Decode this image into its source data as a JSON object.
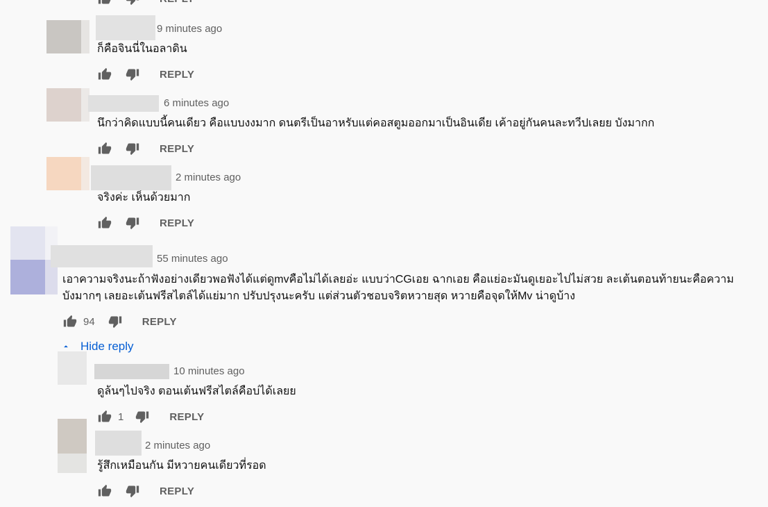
{
  "reply_label": "REPLY",
  "hide_reply_label": "Hide reply",
  "colors": {
    "link": "#065fd4",
    "meta": "#606060",
    "text": "#0f0f0f",
    "background": "#f9f9f9"
  },
  "comments": [
    {
      "time": "9 minutes ago",
      "text": "ก็คือจินนี่ในอลาดิน",
      "likes": ""
    },
    {
      "time": "6 minutes ago",
      "text": "นึกว่าคิดแบบนี้คนเดียว คือแบบงงมาก ดนตรีเป็นอาหรับแต่คอสตูมออกมาเป็นอินเดีย เค้าอยู่กันคนละทวีปเลยย บังมากก",
      "likes": ""
    },
    {
      "time": "2 minutes ago",
      "text": "จริงค่ะ เห็นด้วยมาก",
      "likes": ""
    },
    {
      "time": "55 minutes ago",
      "text_line1": "เอาความจริงนะถ้าฟังอย่างเดียวพอฟังได้แต่ดูmvคือไม่ได้เลยอ่ะ แบบว่าCGเอย ฉากเอย คือแย่อะมันดูเยอะไปไม่สวย ละเต้นตอนท้ายนะคือความ",
      "text_line2": "บังมากๆ เลยอะเต้นฟรีสไตล์ได้แย่มาก ปรับปรุงนะครับ แต่ส่วนตัวชอบจริตหวายสุด หวายคือจุดให้Mv น่าดูบ้าง",
      "likes": "94"
    },
    {
      "time": "10 minutes ago",
      "text": "ดูล้นๆไปจริง ตอนเต้นฟรีสไตล์คือบ่ได้เลยย",
      "likes": "1"
    },
    {
      "time": "2 minutes ago",
      "text": "รู้สึกเหมือนกัน มีหวายคนเดียวที่รอด",
      "likes": ""
    }
  ]
}
